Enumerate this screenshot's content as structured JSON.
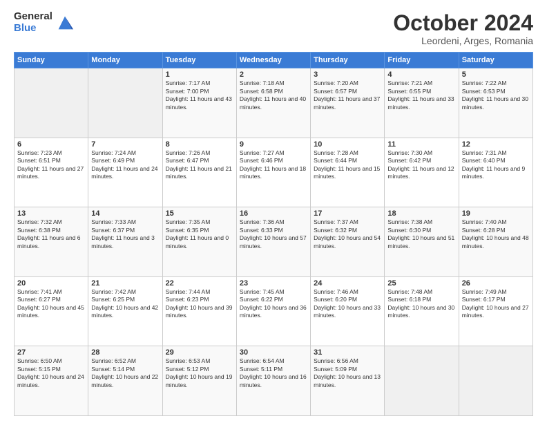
{
  "logo": {
    "general": "General",
    "blue": "Blue"
  },
  "title": "October 2024",
  "location": "Leordeni, Arges, Romania",
  "days_of_week": [
    "Sunday",
    "Monday",
    "Tuesday",
    "Wednesday",
    "Thursday",
    "Friday",
    "Saturday"
  ],
  "weeks": [
    [
      {
        "day": "",
        "sunrise": "",
        "sunset": "",
        "daylight": ""
      },
      {
        "day": "",
        "sunrise": "",
        "sunset": "",
        "daylight": ""
      },
      {
        "day": "1",
        "sunrise": "Sunrise: 7:17 AM",
        "sunset": "Sunset: 7:00 PM",
        "daylight": "Daylight: 11 hours and 43 minutes."
      },
      {
        "day": "2",
        "sunrise": "Sunrise: 7:18 AM",
        "sunset": "Sunset: 6:58 PM",
        "daylight": "Daylight: 11 hours and 40 minutes."
      },
      {
        "day": "3",
        "sunrise": "Sunrise: 7:20 AM",
        "sunset": "Sunset: 6:57 PM",
        "daylight": "Daylight: 11 hours and 37 minutes."
      },
      {
        "day": "4",
        "sunrise": "Sunrise: 7:21 AM",
        "sunset": "Sunset: 6:55 PM",
        "daylight": "Daylight: 11 hours and 33 minutes."
      },
      {
        "day": "5",
        "sunrise": "Sunrise: 7:22 AM",
        "sunset": "Sunset: 6:53 PM",
        "daylight": "Daylight: 11 hours and 30 minutes."
      }
    ],
    [
      {
        "day": "6",
        "sunrise": "Sunrise: 7:23 AM",
        "sunset": "Sunset: 6:51 PM",
        "daylight": "Daylight: 11 hours and 27 minutes."
      },
      {
        "day": "7",
        "sunrise": "Sunrise: 7:24 AM",
        "sunset": "Sunset: 6:49 PM",
        "daylight": "Daylight: 11 hours and 24 minutes."
      },
      {
        "day": "8",
        "sunrise": "Sunrise: 7:26 AM",
        "sunset": "Sunset: 6:47 PM",
        "daylight": "Daylight: 11 hours and 21 minutes."
      },
      {
        "day": "9",
        "sunrise": "Sunrise: 7:27 AM",
        "sunset": "Sunset: 6:46 PM",
        "daylight": "Daylight: 11 hours and 18 minutes."
      },
      {
        "day": "10",
        "sunrise": "Sunrise: 7:28 AM",
        "sunset": "Sunset: 6:44 PM",
        "daylight": "Daylight: 11 hours and 15 minutes."
      },
      {
        "day": "11",
        "sunrise": "Sunrise: 7:30 AM",
        "sunset": "Sunset: 6:42 PM",
        "daylight": "Daylight: 11 hours and 12 minutes."
      },
      {
        "day": "12",
        "sunrise": "Sunrise: 7:31 AM",
        "sunset": "Sunset: 6:40 PM",
        "daylight": "Daylight: 11 hours and 9 minutes."
      }
    ],
    [
      {
        "day": "13",
        "sunrise": "Sunrise: 7:32 AM",
        "sunset": "Sunset: 6:38 PM",
        "daylight": "Daylight: 11 hours and 6 minutes."
      },
      {
        "day": "14",
        "sunrise": "Sunrise: 7:33 AM",
        "sunset": "Sunset: 6:37 PM",
        "daylight": "Daylight: 11 hours and 3 minutes."
      },
      {
        "day": "15",
        "sunrise": "Sunrise: 7:35 AM",
        "sunset": "Sunset: 6:35 PM",
        "daylight": "Daylight: 11 hours and 0 minutes."
      },
      {
        "day": "16",
        "sunrise": "Sunrise: 7:36 AM",
        "sunset": "Sunset: 6:33 PM",
        "daylight": "Daylight: 10 hours and 57 minutes."
      },
      {
        "day": "17",
        "sunrise": "Sunrise: 7:37 AM",
        "sunset": "Sunset: 6:32 PM",
        "daylight": "Daylight: 10 hours and 54 minutes."
      },
      {
        "day": "18",
        "sunrise": "Sunrise: 7:38 AM",
        "sunset": "Sunset: 6:30 PM",
        "daylight": "Daylight: 10 hours and 51 minutes."
      },
      {
        "day": "19",
        "sunrise": "Sunrise: 7:40 AM",
        "sunset": "Sunset: 6:28 PM",
        "daylight": "Daylight: 10 hours and 48 minutes."
      }
    ],
    [
      {
        "day": "20",
        "sunrise": "Sunrise: 7:41 AM",
        "sunset": "Sunset: 6:27 PM",
        "daylight": "Daylight: 10 hours and 45 minutes."
      },
      {
        "day": "21",
        "sunrise": "Sunrise: 7:42 AM",
        "sunset": "Sunset: 6:25 PM",
        "daylight": "Daylight: 10 hours and 42 minutes."
      },
      {
        "day": "22",
        "sunrise": "Sunrise: 7:44 AM",
        "sunset": "Sunset: 6:23 PM",
        "daylight": "Daylight: 10 hours and 39 minutes."
      },
      {
        "day": "23",
        "sunrise": "Sunrise: 7:45 AM",
        "sunset": "Sunset: 6:22 PM",
        "daylight": "Daylight: 10 hours and 36 minutes."
      },
      {
        "day": "24",
        "sunrise": "Sunrise: 7:46 AM",
        "sunset": "Sunset: 6:20 PM",
        "daylight": "Daylight: 10 hours and 33 minutes."
      },
      {
        "day": "25",
        "sunrise": "Sunrise: 7:48 AM",
        "sunset": "Sunset: 6:18 PM",
        "daylight": "Daylight: 10 hours and 30 minutes."
      },
      {
        "day": "26",
        "sunrise": "Sunrise: 7:49 AM",
        "sunset": "Sunset: 6:17 PM",
        "daylight": "Daylight: 10 hours and 27 minutes."
      }
    ],
    [
      {
        "day": "27",
        "sunrise": "Sunrise: 6:50 AM",
        "sunset": "Sunset: 5:15 PM",
        "daylight": "Daylight: 10 hours and 24 minutes."
      },
      {
        "day": "28",
        "sunrise": "Sunrise: 6:52 AM",
        "sunset": "Sunset: 5:14 PM",
        "daylight": "Daylight: 10 hours and 22 minutes."
      },
      {
        "day": "29",
        "sunrise": "Sunrise: 6:53 AM",
        "sunset": "Sunset: 5:12 PM",
        "daylight": "Daylight: 10 hours and 19 minutes."
      },
      {
        "day": "30",
        "sunrise": "Sunrise: 6:54 AM",
        "sunset": "Sunset: 5:11 PM",
        "daylight": "Daylight: 10 hours and 16 minutes."
      },
      {
        "day": "31",
        "sunrise": "Sunrise: 6:56 AM",
        "sunset": "Sunset: 5:09 PM",
        "daylight": "Daylight: 10 hours and 13 minutes."
      },
      {
        "day": "",
        "sunrise": "",
        "sunset": "",
        "daylight": ""
      },
      {
        "day": "",
        "sunrise": "",
        "sunset": "",
        "daylight": ""
      }
    ]
  ]
}
